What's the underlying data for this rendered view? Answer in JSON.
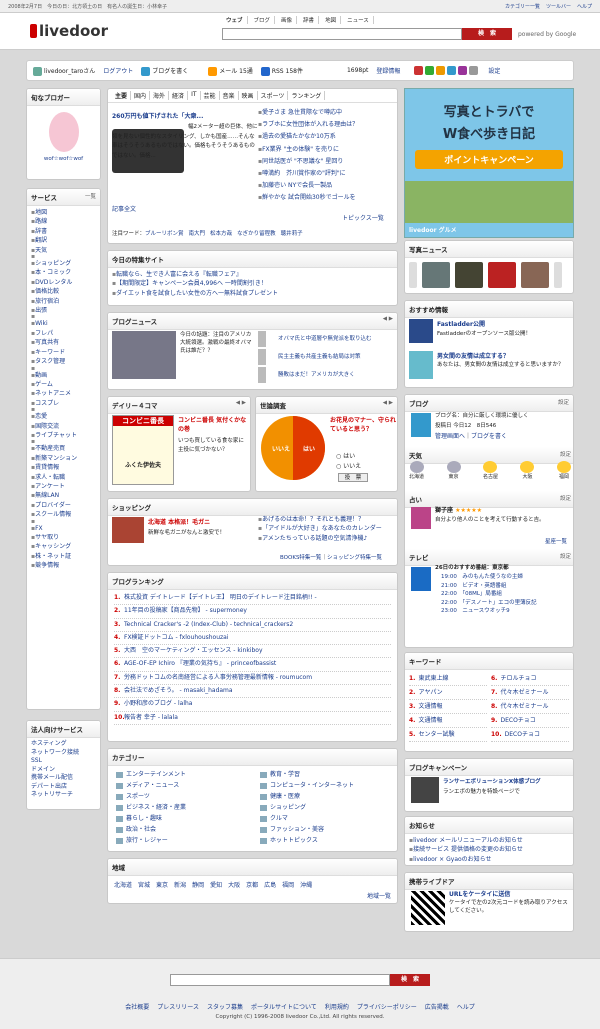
{
  "topbar": {
    "date": "2008年2月7日　今日の日：北方領土の日　有名人の誕生日：小林幸子",
    "links": [
      "カテゴリー一覧",
      "ツールバー",
      "ヘルプ"
    ]
  },
  "header": {
    "logo": "livedoor",
    "tabs": [
      "ウェブ",
      "ブログ",
      "画像",
      "辞書",
      "地図",
      "ニュース"
    ],
    "search_btn": "検　索",
    "powered": "powered by Google"
  },
  "user": {
    "name": "livedoor_taroさん",
    "logout": "ログアウト",
    "blog": "ブログを書く",
    "mail": "メール 15通",
    "rss": "RSS 158件",
    "points": "1698pt",
    "settings": "登録情報",
    "setting2": "設定"
  },
  "left": {
    "blogger_title": "旬なブロガー",
    "blogger_name": "wof☆wof☆wof",
    "service_title": "サービス",
    "service_btn": "一覧",
    "services": [
      "地図",
      "路線",
      "辞書",
      "翻訳",
      "天気",
      "",
      "ショッピング",
      "本・コミック",
      "DVDレンタル",
      "価格比較",
      "旅行宿泊",
      "出張",
      "",
      "Wiki",
      "フレパ",
      "写真共有",
      "キーワード",
      "タスク管理",
      "",
      "動画",
      "ゲーム",
      "ネットアニメ",
      "コスプレ",
      "",
      "恋愛",
      "国際交流",
      "ライブチャット",
      "",
      "不動産売買",
      "新築マンション",
      "賃貸情報",
      "求人・転職",
      "アンケート",
      "無線LAN",
      "プロバイダー",
      "スクール情報",
      "",
      "FX",
      "サヤ取り",
      "キャッシング",
      "株・ネット証",
      "競争情報"
    ],
    "corp_title": "法人向けサービス",
    "corp": [
      "ホスティング",
      "ネットワーク接続",
      "SSL",
      "ドメイン",
      "携帯メール配信",
      "デパート出店",
      "ネットリサーチ"
    ]
  },
  "news": {
    "tabs": [
      "主要",
      "国内",
      "海外",
      "経済",
      "IT",
      "芸能",
      "音楽",
      "映画",
      "スポーツ",
      "ランキング"
    ],
    "feature_title": "260万円も値下げされた「大衆...",
    "feature_text": "幅2メーター超の巨体、他に類を見ない個性的なスタイリング、しかも国産……そんな車はそうそうあるものではない。価格もそうそうあるものではない。価格...",
    "feature_link": "記事全文",
    "items": [
      "愛子さま 急住貫際なで噂応中",
      "ラブホに女性団体が入れる理由は？",
      "過去の愛猫たかなか10万系",
      "FX業界 \"主の体験\" を売りに",
      "同世話医が \"不思議な\" 星回り",
      "噂満約　芥川賞作家の\"評判\"に",
      "加藤壱い NYで会長一製品",
      "鮮やかな 試合開始30秒でゴールを"
    ],
    "topics": "トピックス一覧",
    "attention_label": "注目ワード：",
    "attention": [
      "ブルーリボン賞",
      "南大門",
      "松本方哉",
      "なぎかり留程教",
      "聴井莉子"
    ]
  },
  "today": {
    "title": "今日の特集サイト",
    "items": [
      "転職なら、生でき人富に会える『転職フェア』",
      "【期間限定】キャンペーン会員4,996へ 一時間割引き！",
      "ダイエット食を試食したい女性の方へ一無料試食プレゼント"
    ]
  },
  "blognews": {
    "title": "ブログニュース",
    "lead": "今日の話題：注目のアメリカ大統領選。激戦の最終オバマ氏は誰だ？？",
    "items": [
      "オバマ氏と中道層や無党派を取り込む",
      "民主主義も共産主義も結局は対策",
      "勝敗はまだ！アメリカが大きく"
    ]
  },
  "comic": {
    "title": "デイリー４コマ",
    "strip": "コンビニ番長",
    "t": "コンビニ番長 気付くかなの巻",
    "d": "いつも買している食な家に主役に気づかない？",
    "sub": "ふくた伊佐夫"
  },
  "poll": {
    "title": "世論調査",
    "q": "お花見のマナー、守られていると思う？",
    "yes": "はい",
    "no": "いいえ",
    "btn": "投　票",
    "yes_pct": 0.5
  },
  "shop": {
    "title": "ショッピング",
    "p1": "北海道 本格派！毛ガニ",
    "p1d": "新鮮な毛ガニがなんと激安で！",
    "items": [
      "あげるのは本命！？それとも義理！？",
      "「アイドルが大好き」なあなたのカレンダー",
      "アメンたちっている話題の空気清浄機♪"
    ],
    "books": "BOOKS特集一覧",
    "shoplink": "ショッピング特集一覧"
  },
  "ranking": {
    "title": "ブログランキング",
    "items": [
      "株式投資 デイトレード【デイトレ王】 明日のデイトレード注目銘柄!! - ",
      "11年目の投稿家【商品先物】 - supermoney",
      "Technical Cracker's -2 (Index-Club) - technical_crackers2",
      "FX検証ドットコム - fxlouhoushouzai",
      "大西　空のマーケティング・エッセンス - kinkiboy",
      "AGE-OF-EP Ichiro 『理業の気持ち』 - princeofbassist",
      "労務ドットコムの名南経営による人事労務管理最新情報 - roumucom",
      "会社法でめざそう。 - masaki_hadama",
      "小野和彦のブログ - lalha",
      "報告者 幸子 - lalala"
    ]
  },
  "category": {
    "title": "カテゴリー",
    "col1": [
      "エンターテインメント",
      "メディア・ニュース",
      "スポーツ",
      "ビジネス・経済・産業",
      "暮らし・趣味",
      "政治・社会",
      "旅行・レジャー"
    ],
    "col2": [
      "教育・学習",
      "コンピュータ・インターネット",
      "健康・医療",
      "ショッピング",
      "クルマ",
      "ファッション・美容",
      "ホットトピックス"
    ]
  },
  "area": {
    "title": "地域",
    "items": [
      "北海道",
      "宮城",
      "東京",
      "新潟",
      "静岡",
      "愛知",
      "大阪",
      "京都",
      "広島",
      "福岡",
      "沖縄"
    ],
    "link": "地域一覧"
  },
  "right": {
    "ad_line1": "写真とトラバで",
    "ad_line2": "W食べ歩き日記",
    "ad_line3": "ポイントキャンペーン",
    "ad_brand": "livedoor グルメ",
    "photo_title": "写真ニュース",
    "rec_title": "おすすめ情報",
    "rec1_t": "Fastladder公開",
    "rec1_d": "Fastladderのオープンソース版公開！",
    "rec2_t": "男女間の友情は成立する？",
    "rec2_d": "あなたは、男女間の友情は成立すると思いますか？",
    "blog_title": "ブログ",
    "blog_set": "設定",
    "blog_name": "ブログ名：自分に厳しく環境に優しく",
    "blog_date": "投稿日 今日12　8日546",
    "blog_admin": "管理画面へ",
    "blog_write": "ブログを書く",
    "weather_title": "天気",
    "weather": [
      "北海道",
      "東京",
      "名古屋",
      "大阪",
      "福岡"
    ],
    "fortune_title": "占い",
    "fortune_sign": "獅子座",
    "fortune_text": "自分より他人のことを考えて行動すると吉。",
    "fortune_link": "星座一覧",
    "tv_title": "テレビ",
    "tv_head": "26日のおすすめ番組：東京都",
    "tv": [
      "19:00　みのもんた使うなの主婦",
      "21:00　ビデオ・英語番組",
      "22:00　「08ML」局番組",
      "22:00　「デスノート」エコの里薄反記",
      "23:00　ニュースウオッチ9"
    ],
    "kw_title": "キーワード",
    "kw": [
      "東武東上線",
      "アヤパン",
      "文通情報",
      "文通情報",
      "センター試験",
      "チロルチョコ",
      "代々木ゼミナール",
      "代々木ゼミナール",
      "DECOチョコ",
      "DECOチョコ"
    ],
    "bc_title": "ブログキャンペーン",
    "bc_t": "ランサーエボリューションX体感ブログ",
    "bc_d": "ランエボの魅力を特設ページで",
    "info_title": "お知らせ",
    "info": [
      "livedoor メールリニューアルのお知らせ",
      "接続サービス 提供価格の変更のお知らせ",
      "livedoor × Gyaoのお知らせ"
    ],
    "mobile_title": "携帯ライブドア",
    "mobile_t": "URLをケータイに送信",
    "mobile_d": "ケータイで左の2次元コードを読み取りアクセスしてください。"
  },
  "footer": {
    "search_btn": "検　索",
    "links": [
      "会社概要",
      "プレスリリース",
      "スタッフ募集",
      "ポータルサイトについて",
      "利用規約",
      "プライバシーポリシー",
      "広告掲載",
      "ヘルプ"
    ],
    "copyright": "Copyright (C) 1996-2008 livedoor Co.,Ltd. All rights reserved."
  },
  "colors": {
    "brand_red": "#cc0000",
    "link": "#1a3c8c",
    "search_red": "#b71c1c"
  }
}
